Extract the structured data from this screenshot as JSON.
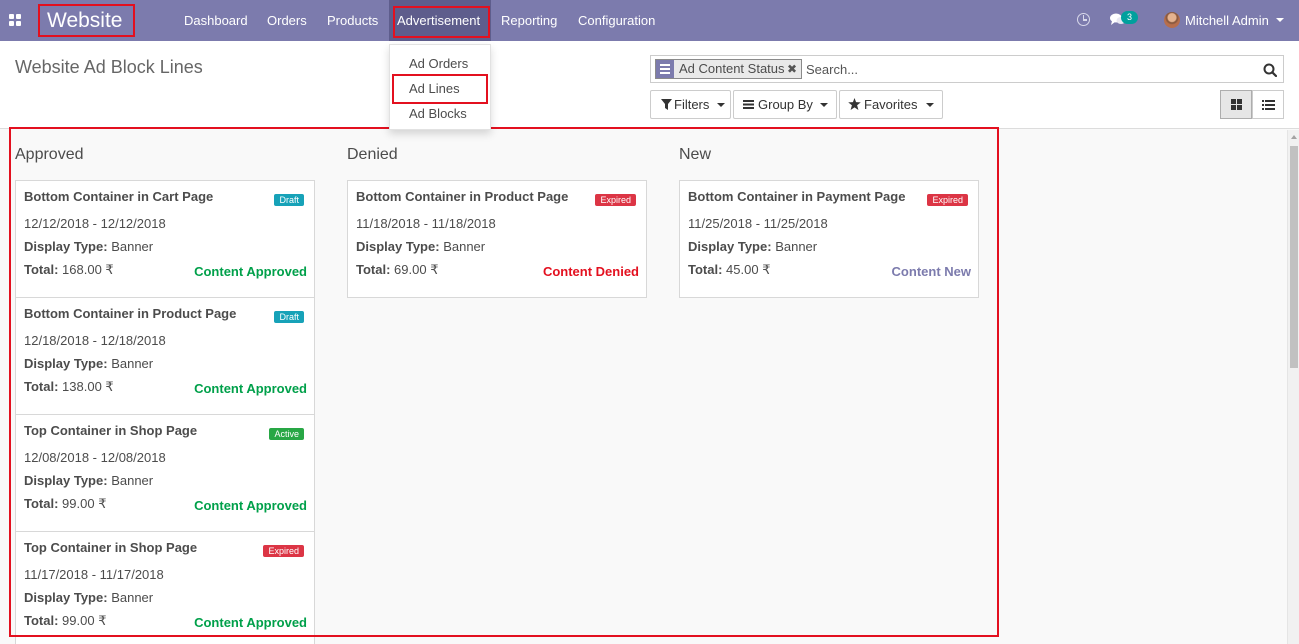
{
  "colors": {
    "navbar": "#7c7bad",
    "highlight_box": "#e3101f",
    "success": "#21b799",
    "approved_text": "#00a04a",
    "denied_text": "#e3101f",
    "new_text": "#7c7bad",
    "draft_badge": "#17a2b8",
    "active_badge": "#28a745",
    "expired_badge": "#dc3545"
  },
  "navbar": {
    "apps_icon": "apps-grid-icon",
    "brand": "Website",
    "menu": [
      "Dashboard",
      "Orders",
      "Products",
      "Advertisement",
      "Reporting",
      "Configuration"
    ],
    "active_menu": "Advertisement",
    "chat_count": "3",
    "user_name": "Mitchell Admin"
  },
  "dropdown": {
    "items": [
      "Ad Orders",
      "Ad Lines",
      "Ad Blocks"
    ],
    "highlighted": "Ad Lines"
  },
  "control_panel": {
    "breadcrumb": "Website Ad Block Lines",
    "facet": "Ad Content Status",
    "search_placeholder": "Search...",
    "filters_label": "Filters",
    "group_by_label": "Group By",
    "favorites_label": "Favorites",
    "views": [
      "kanban",
      "list"
    ],
    "active_view": "kanban"
  },
  "kanban": {
    "columns": [
      {
        "title": "Approved",
        "cards": [
          {
            "title": "Bottom Container in Cart Page",
            "badge": "Draft",
            "dates": "12/12/2018 - 12/12/2018",
            "display_type_label": "Display Type:",
            "display_type": "Banner",
            "total_label": "Total:",
            "total": "168.00 ₹",
            "status": "Content Approved"
          },
          {
            "title": "Bottom Container in Product Page",
            "badge": "Draft",
            "dates": "12/18/2018 - 12/18/2018",
            "display_type_label": "Display Type:",
            "display_type": "Banner",
            "total_label": "Total:",
            "total": "138.00 ₹",
            "status": "Content Approved"
          },
          {
            "title": "Top Container in Shop Page",
            "badge": "Active",
            "dates": "12/08/2018 - 12/08/2018",
            "display_type_label": "Display Type:",
            "display_type": "Banner",
            "total_label": "Total:",
            "total": "99.00 ₹",
            "status": "Content Approved"
          },
          {
            "title": "Top Container in Shop Page",
            "badge": "Expired",
            "dates": "11/17/2018 - 11/17/2018",
            "display_type_label": "Display Type:",
            "display_type": "Banner",
            "total_label": "Total:",
            "total": "99.00 ₹",
            "status": "Content Approved"
          }
        ]
      },
      {
        "title": "Denied",
        "cards": [
          {
            "title": "Bottom Container in Product Page",
            "badge": "Expired",
            "dates": "11/18/2018 - 11/18/2018",
            "display_type_label": "Display Type:",
            "display_type": "Banner",
            "total_label": "Total:",
            "total": "69.00 ₹",
            "status": "Content Denied"
          }
        ]
      },
      {
        "title": "New",
        "cards": [
          {
            "title": "Bottom Container in Payment Page",
            "badge": "Expired",
            "dates": "11/25/2018 - 11/25/2018",
            "display_type_label": "Display Type:",
            "display_type": "Banner",
            "total_label": "Total:",
            "total": "45.00 ₹",
            "status": "Content New"
          }
        ]
      }
    ]
  }
}
